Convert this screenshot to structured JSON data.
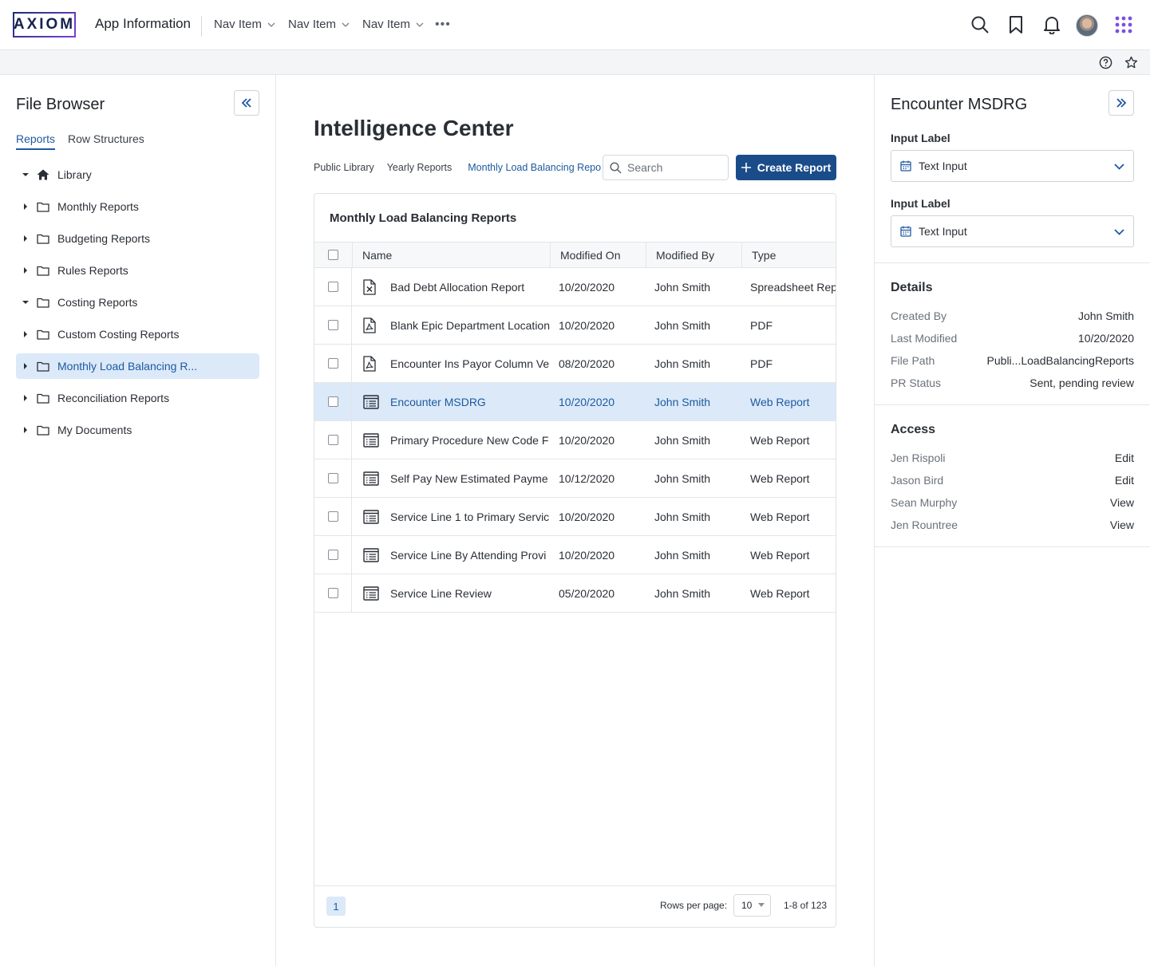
{
  "header": {
    "logo": "AXIOM",
    "app_title": "App Information",
    "nav_items": [
      "Nav Item",
      "Nav Item",
      "Nav Item"
    ],
    "more": "•••",
    "icons": [
      "search-icon",
      "bookmark-icon",
      "bell-icon",
      "avatar",
      "apps-grid-icon"
    ]
  },
  "utility": {
    "icons": [
      "help-icon",
      "star-icon"
    ]
  },
  "sidebar": {
    "title": "File Browser",
    "tabs": [
      "Reports",
      "Row Structures"
    ],
    "active_tab": "Reports",
    "tree": [
      {
        "label": "Library",
        "icon": "home-icon",
        "expanded": true
      },
      {
        "label": "Monthly Reports",
        "icon": "folder-icon",
        "expanded": false
      },
      {
        "label": "Budgeting Reports",
        "icon": "folder-icon",
        "expanded": false
      },
      {
        "label": "Rules Reports",
        "icon": "folder-icon",
        "expanded": false
      },
      {
        "label": "Costing Reports",
        "icon": "folder-icon",
        "expanded": true
      },
      {
        "label": "Custom Costing Reports",
        "icon": "folder-icon",
        "expanded": false
      },
      {
        "label": "Monthly Load Balancing R...",
        "icon": "folder-icon",
        "expanded": false,
        "selected": true
      },
      {
        "label": "Reconciliation Reports",
        "icon": "folder-icon",
        "expanded": false
      },
      {
        "label": "My Documents",
        "icon": "folder-icon",
        "expanded": false
      }
    ]
  },
  "main": {
    "title": "Intelligence Center",
    "breadcrumb": [
      "Public Library",
      "Yearly Reports",
      "Monthly Load Balancing Reports"
    ],
    "search_placeholder": "Search",
    "create_label": "Create Report",
    "card_title": "Monthly Load Balancing Reports",
    "columns": [
      "Name",
      "Modified On",
      "Modified By",
      "Type"
    ],
    "rows": [
      {
        "name": "Bad Debt Allocation Report",
        "modified_on": "10/20/2020",
        "modified_by": "John Smith",
        "type": "Spreadsheet Report",
        "icon": "excel-file-icon"
      },
      {
        "name": "Blank Epic Department Location",
        "modified_on": "10/20/2020",
        "modified_by": "John Smith",
        "type": "PDF",
        "icon": "pdf-file-icon"
      },
      {
        "name": "Encounter Ins Payor Column Ve",
        "modified_on": "08/20/2020",
        "modified_by": "John Smith",
        "type": "PDF",
        "icon": "pdf-file-icon"
      },
      {
        "name": "Encounter MSDRG",
        "modified_on": "10/20/2020",
        "modified_by": "John Smith",
        "type": "Web Report",
        "icon": "web-report-icon",
        "selected": true
      },
      {
        "name": "Primary Procedure New Code F",
        "modified_on": "10/20/2020",
        "modified_by": "John Smith",
        "type": "Web Report",
        "icon": "web-report-icon"
      },
      {
        "name": "Self Pay New Estimated Payme",
        "modified_on": "10/12/2020",
        "modified_by": "John Smith",
        "type": "Web Report",
        "icon": "web-report-icon"
      },
      {
        "name": "Service Line 1 to Primary Servic",
        "modified_on": "10/20/2020",
        "modified_by": "John Smith",
        "type": "Web Report",
        "icon": "web-report-icon"
      },
      {
        "name": "Service Line By Attending Provi",
        "modified_on": "10/20/2020",
        "modified_by": "John Smith",
        "type": "Web Report",
        "icon": "web-report-icon"
      },
      {
        "name": "Service Line Review",
        "modified_on": "05/20/2020",
        "modified_by": "John Smith",
        "type": "Web Report",
        "icon": "web-report-icon"
      }
    ],
    "pager": {
      "current_page": "1",
      "rows_label": "Rows per page:",
      "rows_value": "10",
      "range": "1-8 of 123"
    }
  },
  "panel": {
    "title": "Encounter MSDRG",
    "fields": [
      {
        "label": "Input Label",
        "value": "Text Input"
      },
      {
        "label": "Input Label",
        "value": "Text Input"
      }
    ],
    "details_title": "Details",
    "details": [
      {
        "key": "Created By",
        "value": "John Smith"
      },
      {
        "key": "Last Modified",
        "value": "10/20/2020"
      },
      {
        "key": "File Path",
        "value": "Publi...LoadBalancingReports"
      },
      {
        "key": "PR Status",
        "value": "Sent, pending review"
      }
    ],
    "access_title": "Access",
    "access": [
      {
        "key": "Jen Rispoli",
        "value": "Edit"
      },
      {
        "key": "Jason Bird",
        "value": "Edit"
      },
      {
        "key": "Sean Murphy",
        "value": "View"
      },
      {
        "key": "Jen Rountree",
        "value": "View"
      }
    ]
  },
  "colors": {
    "accent": "#1e5aa0",
    "primary_button": "#1b4c8a",
    "selection": "#dbe9f9",
    "apps_grid": "#7b4fe0"
  }
}
